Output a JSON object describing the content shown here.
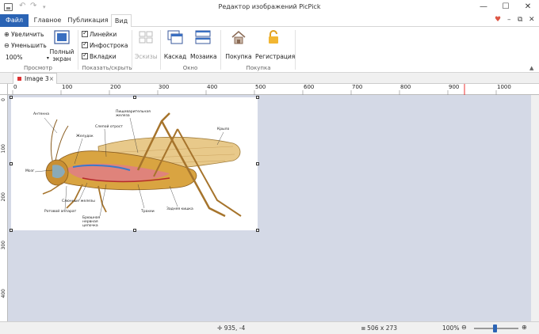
{
  "window": {
    "title": "Редактор изображений PicPick"
  },
  "tabs": {
    "file": "Файл",
    "home": "Главное",
    "share": "Публикация",
    "view": "Вид"
  },
  "ribbon": {
    "zoom_in": "Увеличить",
    "zoom_out": "Уменьшить",
    "zoom_level": "100%",
    "fullscreen": "Полный экран",
    "group_view": "Просмотр",
    "rulers": "Линейки",
    "infobar": "Инфострока",
    "tabs_check": "Вкладки",
    "group_showhide": "Показать/скрыть",
    "thumbnails": "Эскизы",
    "cascade": "Каскад",
    "mosaic": "Мозаика",
    "group_window": "Окно",
    "purchase": "Покупка",
    "register": "Регистрация",
    "group_purchase": "Покупка"
  },
  "document": {
    "tab_label": "Image 3"
  },
  "ruler_h": {
    "ticks": [
      "0",
      "100",
      "200",
      "300",
      "400",
      "500",
      "600",
      "700",
      "800",
      "900",
      "1000"
    ]
  },
  "ruler_v": {
    "ticks": [
      "0",
      "100",
      "200",
      "300",
      "400"
    ]
  },
  "image_labels": {
    "antenna": "Антенна",
    "digestive": "Пищеварительная железа",
    "eye": "Слепой отрост",
    "wing": "Крыло",
    "ganglion": "Желудок",
    "brain": "Мозг",
    "mouth": "Ротовой аппарат",
    "salivary": "Слюнные железы",
    "nerve": "Брюшная нервная цепочка",
    "trachea": "Трахеи",
    "intestine": "Задняя кишка"
  },
  "status": {
    "cursor": "935, -4",
    "size": "506 x 273",
    "zoom": "100%"
  },
  "colors": {
    "accent": "#2a63b4",
    "canvas": "#d4d9e6"
  }
}
